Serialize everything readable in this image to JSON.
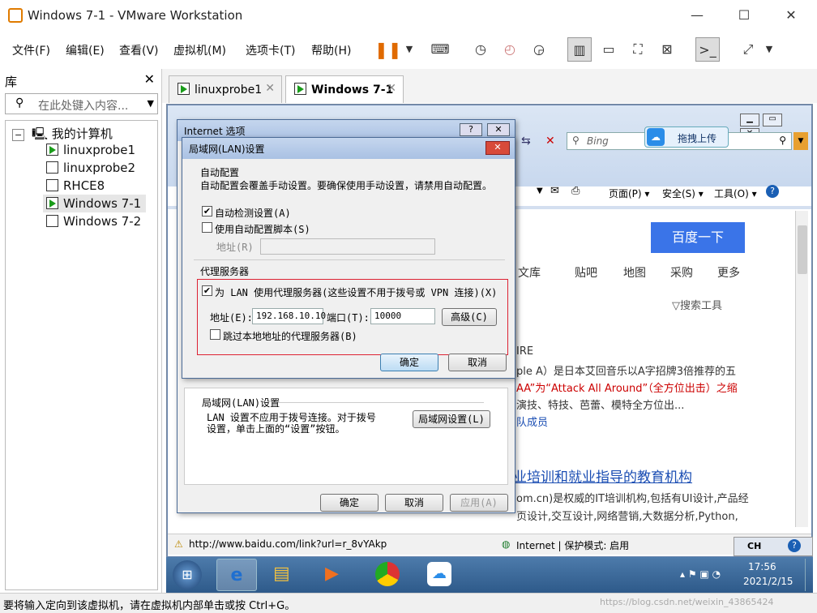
{
  "window": {
    "title": "Windows 7-1 - VMware Workstation",
    "minimize": "—",
    "maximize": "☐",
    "close": "✕"
  },
  "menu": [
    "文件(F)",
    "编辑(E)",
    "查看(V)",
    "虚拟机(M)",
    "选项卡(T)",
    "帮助(H)"
  ],
  "library": {
    "title": "库",
    "close": "✕",
    "search_placeholder": "在此处键入内容...",
    "root": "我的计算机",
    "vms": [
      "linuxprobe1",
      "linuxprobe2",
      "RHCE8",
      "Windows 7-1",
      "Windows 7-2"
    ]
  },
  "tabs": [
    {
      "label": "linuxprobe1"
    },
    {
      "label": "Windows 7-1"
    }
  ],
  "ie": {
    "search_placeholder": "Bing",
    "upload_btn": "拖拽上传",
    "menu": [
      "页面(P) ▾",
      "安全(S) ▾",
      "工具(O) ▾"
    ],
    "baidu_btn": "百度一下",
    "nav": [
      "文库",
      "贴吧",
      "地图",
      "采购",
      "更多"
    ],
    "search_tools": "▽搜索工具",
    "frag": [
      "IRE",
      "ple A）是日本艾回音乐以A字招牌3倍推荐的五",
      "AA”为“Attack All Around”（全方位出击）之缩",
      "演技、特技、芭蕾、模特全方位出...",
      "队成员"
    ],
    "link2": "业培训和就业指导的教育机构",
    "frag2": [
      "om.cn)是权威的IT培训机构,包括有UI设计,产品经",
      "页设计,交互设计,网络营销,大数据分析,Python,"
    ],
    "url": "http://www.baidu.com/link?url=r_8vYAkp",
    "zone": "Internet | 保护模式: 启用"
  },
  "inet_options": {
    "title": "Internet 选项",
    "lan_group": "局域网(LAN)设置",
    "lan_desc": "LAN 设置不应用于拨号连接。对于拨号设置，单击上面的“设置”按钮。",
    "lan_btn": "局域网设置(L)",
    "ok": "确定",
    "cancel": "取消",
    "apply": "应用(A)"
  },
  "lan_dialog": {
    "title": "局域网(LAN)设置",
    "auto_group": "自动配置",
    "auto_desc": "自动配置会覆盖手动设置。要确保使用手动设置，请禁用自动配置。",
    "auto_detect": "自动检测设置(A)",
    "auto_script": "使用自动配置脚本(S)",
    "addr_label": "地址(R)",
    "proxy_group": "代理服务器",
    "use_proxy": "为 LAN 使用代理服务器(这些设置不用于拨号或 VPN 连接)(X)",
    "addr": "地址(E):",
    "addr_value": "192.168.10.10",
    "port": "端口(T):",
    "port_value": "10000",
    "advanced": "高级(C)",
    "bypass": "跳过本地地址的代理服务器(B)",
    "ok": "确定",
    "cancel": "取消",
    "checked": [
      "auto_detect",
      "use_proxy"
    ]
  },
  "taskbar": {
    "time": "17:56",
    "date": "2021/2/15",
    "ime": "CH"
  },
  "status": "要将输入定向到该虚拟机，请在虚拟机内部单击或按 Ctrl+G。",
  "watermark": "https://blog.csdn.net/weixin_43865424"
}
